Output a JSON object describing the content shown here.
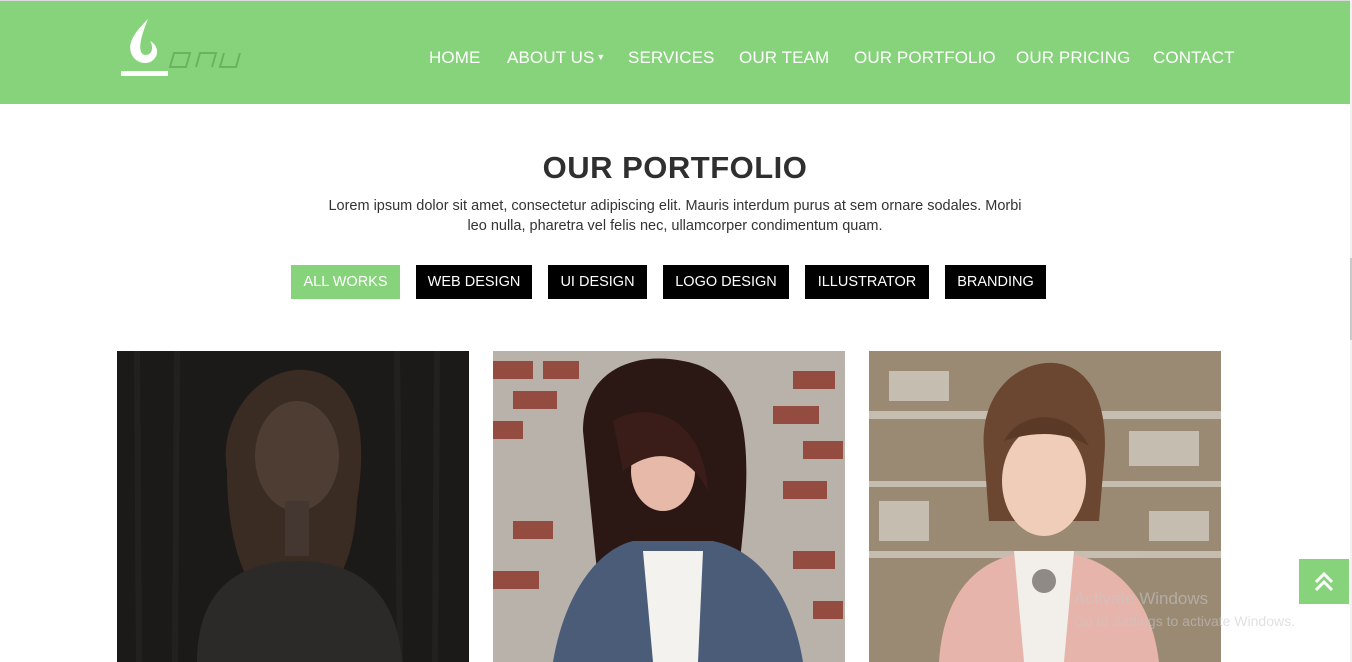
{
  "brand": {
    "logo_text": "onu",
    "accent_color": "#87d37c"
  },
  "nav": {
    "items": [
      {
        "label": "HOME"
      },
      {
        "label": "ABOUT US"
      },
      {
        "label": "SERVICES"
      },
      {
        "label": "OUR TEAM"
      },
      {
        "label": "OUR PORTFOLIO"
      },
      {
        "label": "OUR PRICING"
      },
      {
        "label": "CONTACT"
      }
    ],
    "about_caret": "▼"
  },
  "portfolio": {
    "title": "OUR PORTFOLIO",
    "description": "Lorem ipsum dolor sit amet, consectetur adipiscing elit. Mauris interdum purus at sem ornare sodales. Morbi leo nulla, pharetra vel felis nec, ullamcorper condimentum quam.",
    "filters": [
      {
        "label": "ALL WORKS",
        "active": true
      },
      {
        "label": "WEB DESIGN",
        "active": false
      },
      {
        "label": "UI DESIGN",
        "active": false
      },
      {
        "label": "LOGO DESIGN",
        "active": false
      },
      {
        "label": "ILLUSTRATOR",
        "active": false
      },
      {
        "label": "BRANDING",
        "active": false
      }
    ],
    "items": [
      {
        "image": "portfolio-photo-woman-smiling-dark"
      },
      {
        "image": "portfolio-photo-woman-brick-wall"
      },
      {
        "image": "portfolio-photo-woman-pink-blazer"
      }
    ]
  },
  "back_to_top": {
    "icon": "double-chevron-up-icon"
  },
  "watermark": {
    "line1": "Activate Windows",
    "line2": "Go to Settings to activate Windows."
  }
}
